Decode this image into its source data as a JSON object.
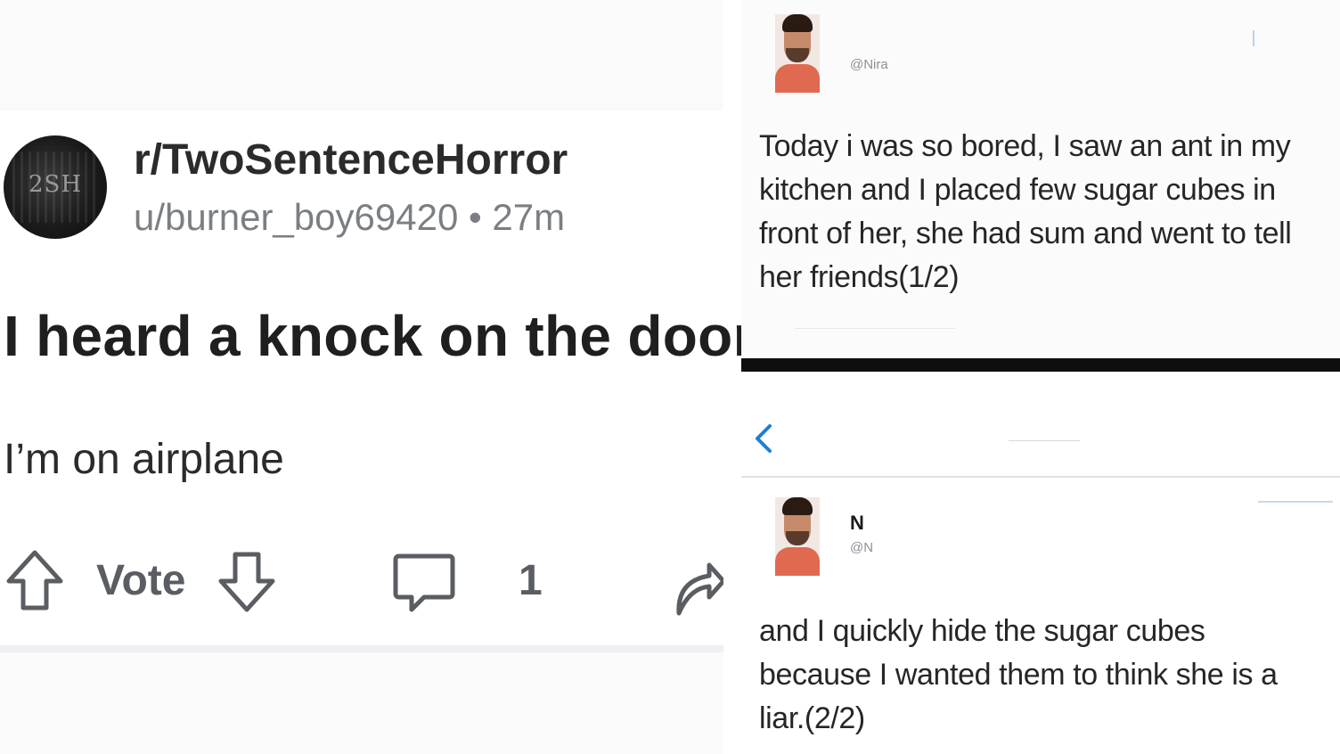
{
  "reddit": {
    "avatar_text": "2SH",
    "subreddit": "r/TwoSentenceHorror",
    "user": "u/burner_boy69420",
    "separator": "•",
    "age": "27m",
    "title": "I heard a knock on the door",
    "body": "I’m on airplane",
    "actions": {
      "vote_label": "Vote",
      "comment_count": "1"
    }
  },
  "tweets": [
    {
      "name": "",
      "handle": "@Nira",
      "text": "Today i was so bored, I saw an ant in my kitchen and I placed few sugar cubes in front of her, she had sum and went to tell her friends(1/2)"
    },
    {
      "name": "N",
      "handle": "@N",
      "text": "and I quickly hide the sugar cubes because I wanted them to think she is a liar.(2/2)"
    }
  ],
  "colors": {
    "link_blue": "#1d7fd1",
    "black_bar": "#0e0e0e",
    "meta_gray": "#7b7f84"
  },
  "icons": {
    "upvote": "arrow-up-outline",
    "downvote": "arrow-down-outline",
    "comment": "speech-bubble-outline",
    "share": "curved-share-arrow",
    "back": "chevron-left"
  }
}
